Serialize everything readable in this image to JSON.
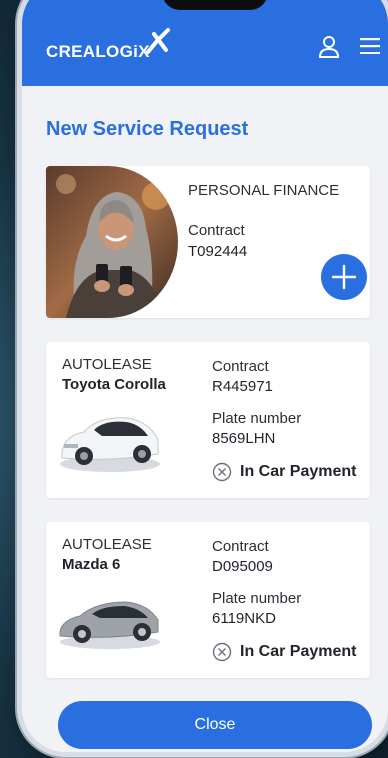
{
  "header": {
    "brand": "CREALOGiX",
    "accent": "#2a6fe0"
  },
  "page": {
    "title": "New Service Request"
  },
  "personal_finance": {
    "category": "PERSONAL FINANCE",
    "contract_label": "Contract",
    "contract_value": "T092444",
    "add_icon": "plus-icon"
  },
  "vehicles": [
    {
      "category": "AUTOLEASE",
      "model": "Toyota Corolla",
      "contract_label": "Contract",
      "contract_value": "R445971",
      "plate_label": "Plate number",
      "plate_value": "8569LHN",
      "payment_label": "In Car Payment",
      "car_color": "#f4f5f7"
    },
    {
      "category": "AUTOLEASE",
      "model": "Mazda 6",
      "contract_label": "Contract",
      "contract_value": "D095009",
      "plate_label": "Plate number",
      "plate_value": "6119NKD",
      "payment_label": "In Car Payment",
      "car_color": "#9ea3a9"
    }
  ],
  "footer": {
    "close_label": "Close"
  }
}
